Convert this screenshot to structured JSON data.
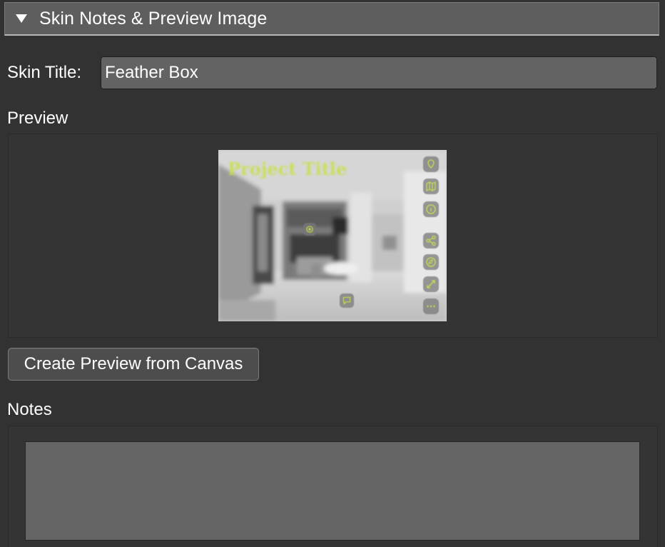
{
  "section": {
    "title": "Skin Notes & Preview Image",
    "expanded": true
  },
  "skin_title": {
    "label": "Skin Title:",
    "value": "Feather Box"
  },
  "preview": {
    "label": "Preview",
    "image_title": "Project Title",
    "image_icons": [
      "location-pin-icon",
      "map-icon",
      "info-icon",
      "share-icon",
      "compass-icon",
      "fullscreen-icon",
      "more-icon",
      "hotspot-icon",
      "chat-icon"
    ],
    "accent_color": "#c8e04a"
  },
  "actions": {
    "create_preview_label": "Create Preview from Canvas"
  },
  "notes": {
    "label": "Notes",
    "value": ""
  },
  "colors": {
    "background": "#323232",
    "header": "#5e5e5e",
    "input": "#636363"
  }
}
